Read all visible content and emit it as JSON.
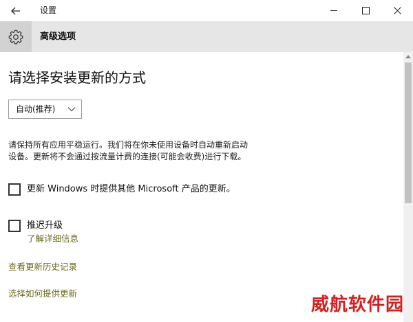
{
  "window": {
    "title": "设置"
  },
  "header": {
    "title": "高级选项"
  },
  "main": {
    "heading": "请选择安装更新的方式",
    "dropdown": {
      "selected": "自动(推荐)"
    },
    "description": [
      "请保持所有应用平稳运行。我们将在你未使用设备时自动重新启动",
      "设备。更新将不会通过按流量计费的连接(可能会收费)进行下载。"
    ],
    "options": [
      {
        "label": "更新 Windows 时提供其他 Microsoft 产品的更新。",
        "checked": false
      },
      {
        "label": "推迟升级",
        "checked": false,
        "link": "了解详细信息"
      }
    ],
    "links": {
      "history": "查看更新历史记录",
      "delivery": "选择如何提供更新"
    }
  },
  "watermark": "威航软件园",
  "colors": {
    "link": "#6b6b1e",
    "header_bg": "#e6e6e6",
    "gear_bg": "#d2d2d2",
    "watermark": "#d42020"
  }
}
